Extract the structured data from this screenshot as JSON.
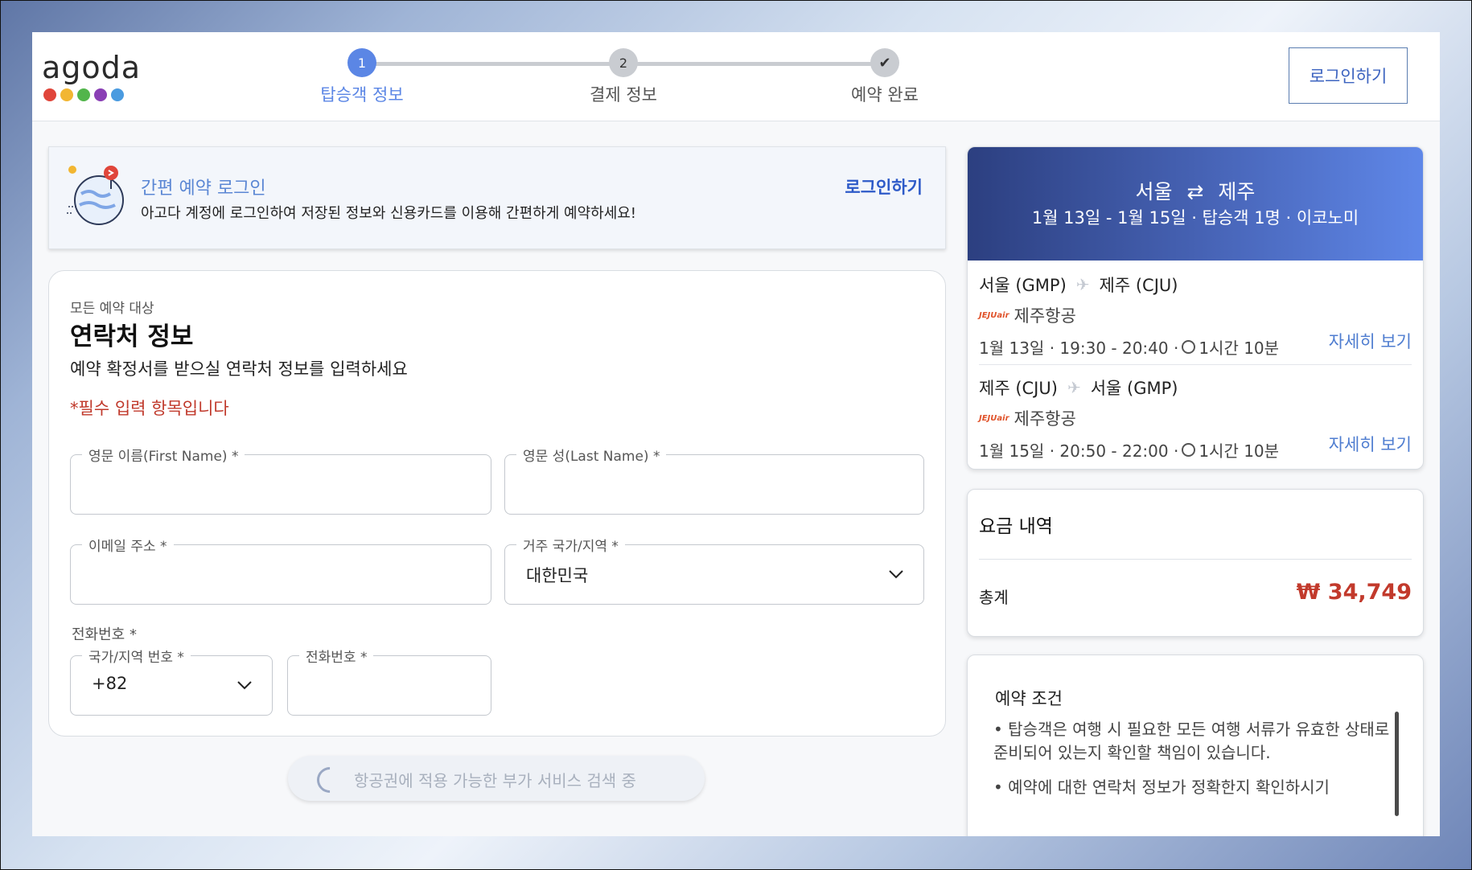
{
  "brand": {
    "name": "agoda",
    "dot_colors": [
      "#e0453a",
      "#f2b632",
      "#52b54b",
      "#8a3fb5",
      "#4a9be0"
    ]
  },
  "steps": [
    {
      "number": "1",
      "label": "탑승객 정보",
      "state": "active"
    },
    {
      "number": "2",
      "label": "결제 정보",
      "state": "pending"
    },
    {
      "number": "✔",
      "label": "예약 완료",
      "state": "pending"
    }
  ],
  "header": {
    "login_button": "로그인하기"
  },
  "login_banner": {
    "title": "간편 예약 로그인",
    "description": "아고다 계정에 로그인하여 저장된 정보와 신용카드를 이용해 간편하게 예약하세요!",
    "link": "로그인하기"
  },
  "contact": {
    "eyebrow": "모든 예약 대상",
    "title": "연락처 정보",
    "description": "예약 확정서를 받으실 연락처 정보를 입력하세요",
    "required_note": "*필수 입력 항목입니다",
    "first_name_label": "영문 이름(First Name) *",
    "first_name_value": "",
    "last_name_label": "영문 성(Last Name) *",
    "last_name_value": "",
    "email_label": "이메일 주소 *",
    "email_value": "",
    "country_label": "거주 국가/지역 *",
    "country_value": "대한민국",
    "phone_heading": "전화번호 *",
    "phone_code_label": "국가/지역 번호 *",
    "phone_code_value": "+82",
    "phone_label": "전화번호 *",
    "phone_value": ""
  },
  "addon_status": "항공권에 적용 가능한 부가 서비스 검색 중",
  "trip": {
    "origin": "서울",
    "swap_icon": "⇄",
    "destination": "제주",
    "summary": "1월 13일 - 1월 15일 · 탑승객 1명 · 이코노미",
    "segments": [
      {
        "from": "서울 (GMP)",
        "to": "제주 (CJU)",
        "airline": "제주항공",
        "date_time": "1월 13일 · 19:30 - 20:40 ·",
        "duration": "1시간 10분",
        "details": "자세히 보기"
      },
      {
        "from": "제주 (CJU)",
        "to": "서울 (GMP)",
        "airline": "제주항공",
        "date_time": "1월 15일 · 20:50 - 22:00 ·",
        "duration": "1시간 10분",
        "details": "자세히 보기"
      }
    ]
  },
  "price": {
    "title": "요금 내역",
    "total_label": "총계",
    "total_value": "₩ 34,749"
  },
  "terms": {
    "title": "예약 조건",
    "items": [
      "• 탑승객은 여행 시 필요한 모든 여행 서류가 유효한 상태로 준비되어 있는지 확인할 책임이 있습니다.",
      "• 예약에 대한 연락처 정보가 정확한지 확인하시기"
    ]
  },
  "colors": {
    "accent": "#3d64c0",
    "active_step": "#5b86e5",
    "price": "#c23a2c",
    "required": "#c0392b"
  }
}
